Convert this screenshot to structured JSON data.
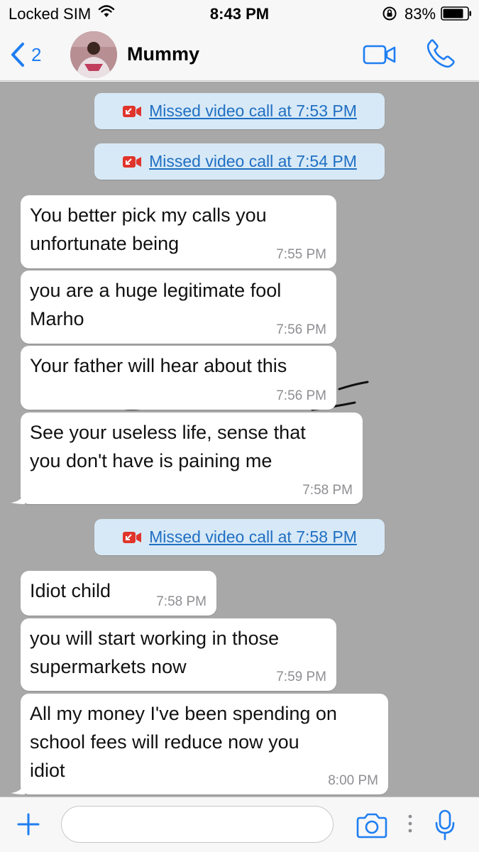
{
  "status_bar": {
    "carrier": "Locked SIM",
    "time": "8:43 PM",
    "battery_percent": "83%"
  },
  "nav": {
    "back_count": "2",
    "contact_name": "Mummy"
  },
  "system_messages": [
    {
      "text": "Missed video call at 7:53 PM"
    },
    {
      "text": "Missed video call at 7:54 PM"
    },
    {
      "text": "Missed video call at 7:58 PM"
    }
  ],
  "messages": [
    {
      "text": "You better pick my calls you\nunfortunate being",
      "time": "7:55 PM"
    },
    {
      "text": "you are a huge legitimate fool\nMarho",
      "time": "7:56 PM"
    },
    {
      "text": "Your father will hear about this",
      "time": "7:56 PM"
    },
    {
      "text": "See your useless life, sense that\nyou don't have is paining me",
      "time": "7:58 PM"
    },
    {
      "text": "Idiot child",
      "time": "7:58 PM"
    },
    {
      "text": "you will start working in those\nsupermarkets now",
      "time": "7:59 PM"
    },
    {
      "text": "All my money I've been spending on\nschool fees will reduce now you\nidiot",
      "time": "8:00 PM"
    }
  ],
  "input": {
    "value": ""
  },
  "colors": {
    "accent": "#1e7ef2",
    "chat_background": "#a8a8a8",
    "system_bubble": "#d7e9f7",
    "missed_call_icon": "#e0352b"
  }
}
